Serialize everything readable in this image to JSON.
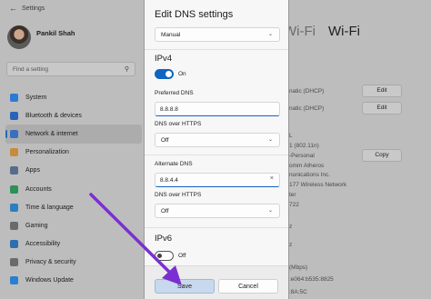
{
  "window": {
    "title": "Settings"
  },
  "profile": {
    "name": "Pankil Shah"
  },
  "search": {
    "placeholder": "Find a setting",
    "icon": "search-icon"
  },
  "sidebar": {
    "items": [
      {
        "label": "System",
        "icon": "monitor-icon",
        "color": "#2d7ad6"
      },
      {
        "label": "Bluetooth & devices",
        "icon": "bluetooth-icon",
        "color": "#2a63b8"
      },
      {
        "label": "Network & internet",
        "icon": "wifi-icon",
        "color": "#3a6fbf",
        "active": true
      },
      {
        "label": "Personalization",
        "icon": "brush-icon",
        "color": "#c98a3a"
      },
      {
        "label": "Apps",
        "icon": "apps-icon",
        "color": "#5a6a8a"
      },
      {
        "label": "Accounts",
        "icon": "person-icon",
        "color": "#2f8f5a"
      },
      {
        "label": "Time & language",
        "icon": "globe-clock-icon",
        "color": "#2a7fc0"
      },
      {
        "label": "Gaming",
        "icon": "controller-icon",
        "color": "#6a6a6a"
      },
      {
        "label": "Accessibility",
        "icon": "accessibility-icon",
        "color": "#2a6fb0"
      },
      {
        "label": "Privacy & security",
        "icon": "shield-icon",
        "color": "#6b6b6b"
      },
      {
        "label": "Windows Update",
        "icon": "refresh-icon",
        "color": "#2a7fd0"
      }
    ]
  },
  "background_page": {
    "title_left": "Wi-Fi",
    "title_right": "Wi-Fi",
    "rows": [
      {
        "text": "natic (DHCP)",
        "button": "Edit"
      },
      {
        "text": "natic (DHCP)",
        "button": "Edit"
      },
      {
        "text": "L"
      },
      {
        "text": "1 (802.11n)"
      },
      {
        "text": "-Personal",
        "button": "Copy"
      },
      {
        "text": "omm Atheros"
      },
      {
        "text": "nunications Inc."
      },
      {
        "text": "177 Wireless Network"
      },
      {
        "text": "ter"
      },
      {
        "text": "722"
      },
      {
        "text": "z"
      },
      {
        "text": "z"
      },
      {
        "text": "(Mbps)"
      },
      {
        "text": ":e064:b535:8825"
      },
      {
        "text": ":8A:5C"
      }
    ]
  },
  "dialog": {
    "title": "Edit DNS settings",
    "mode": "Manual",
    "ipv4": {
      "heading": "IPv4",
      "toggle_state": "On",
      "preferred_label": "Preferred DNS",
      "preferred_value": "8.8.8.8",
      "preferred_https_label": "DNS over HTTPS",
      "preferred_https_value": "Off",
      "alternate_label": "Alternate DNS",
      "alternate_value": "8.8.4.4",
      "alternate_https_label": "DNS over HTTPS",
      "alternate_https_value": "Off"
    },
    "ipv6": {
      "heading": "IPv6",
      "toggle_state": "Off"
    },
    "save_label": "Save",
    "cancel_label": "Cancel"
  },
  "colors": {
    "accent": "#0f64c0",
    "annotation_arrow": "#7b2fd1"
  }
}
